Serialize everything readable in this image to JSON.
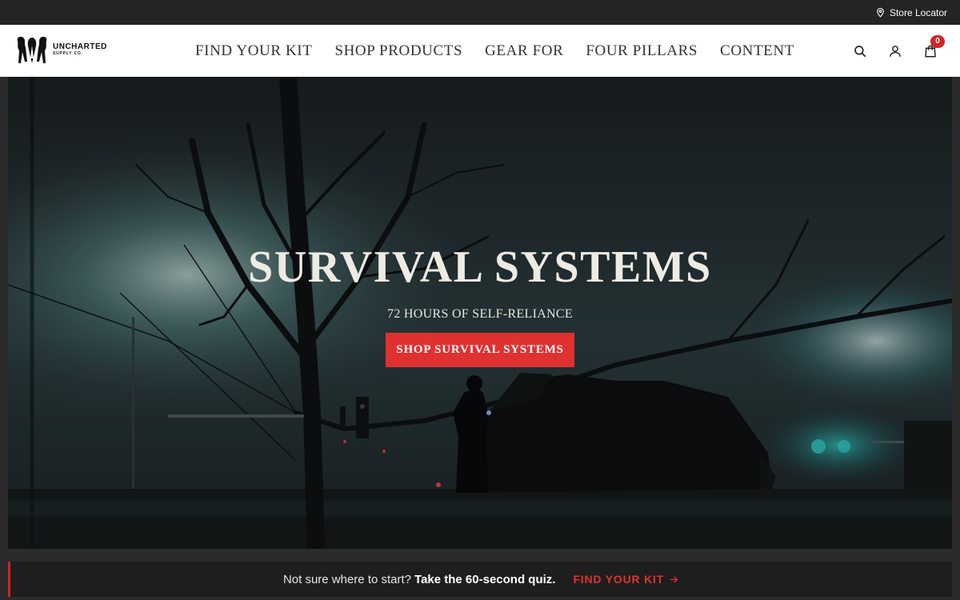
{
  "utility": {
    "store_locator_label": "Store Locator",
    "store_locator_icon": "map-pin-icon"
  },
  "header": {
    "logo_text": "UNCHARTED",
    "logo_subtext": "SUPPLY CO.",
    "nav": [
      {
        "label": "FIND YOUR KIT"
      },
      {
        "label": "SHOP PRODUCTS"
      },
      {
        "label": "GEAR FOR"
      },
      {
        "label": "FOUR PILLARS"
      },
      {
        "label": "CONTENT"
      }
    ],
    "icons": {
      "search": "search-icon",
      "account": "user-icon",
      "cart": "shopping-bag-icon"
    },
    "cart_count": "0"
  },
  "hero": {
    "title": "SURVIVAL SYSTEMS",
    "subtitle": "72 HOURS OF SELF-RELIANCE",
    "cta_label": "SHOP SURVIVAL SYSTEMS"
  },
  "quiz_banner": {
    "lead_text": "Not sure where to start?",
    "strong_text": "Take the 60-second quiz.",
    "link_label": "FIND YOUR KIT",
    "link_icon": "arrow-right-icon"
  },
  "colors": {
    "accent_red": "#e03131",
    "header_bg": "#ffffff",
    "utility_bg": "#242424",
    "banner_bg": "#1e1e1e"
  }
}
